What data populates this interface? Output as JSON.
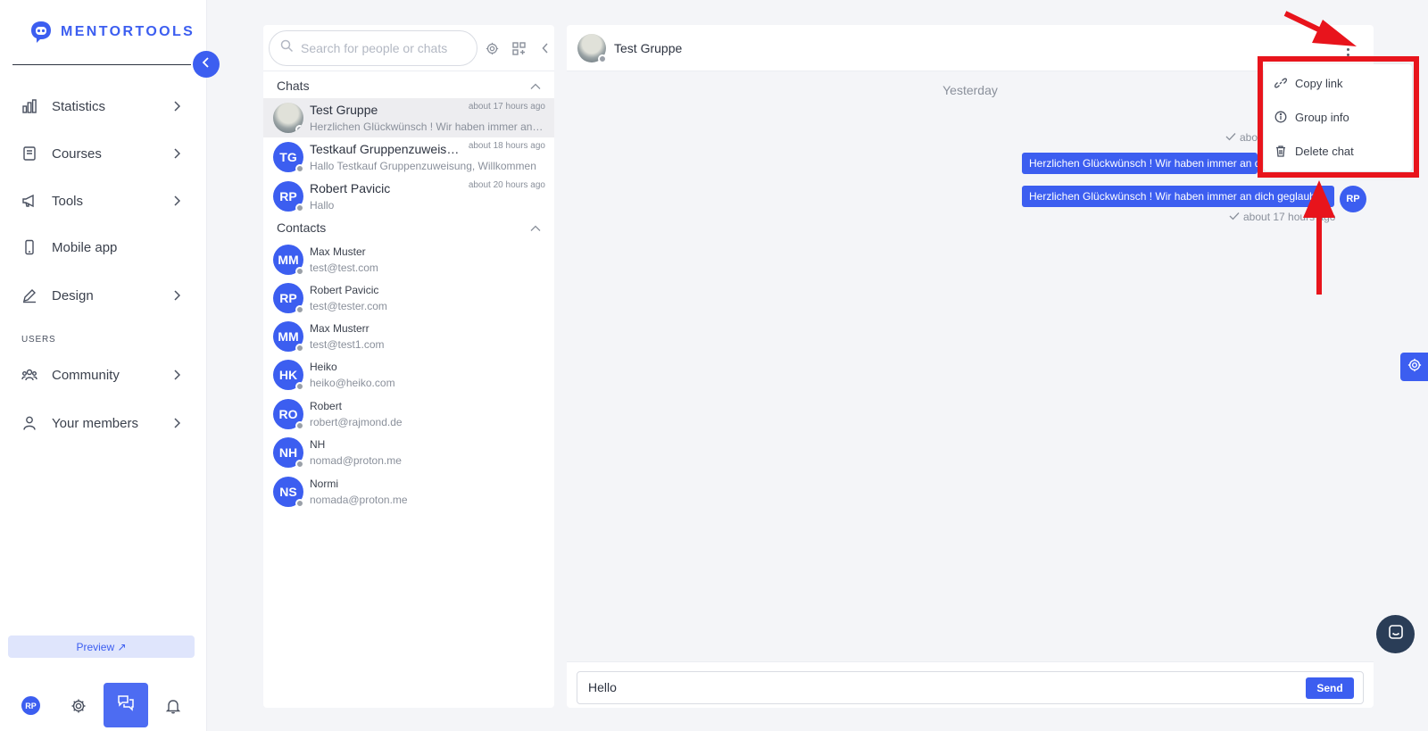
{
  "brand": {
    "name": "MENTORTOOLS",
    "color": "#3c5ef0"
  },
  "sidebar": {
    "items": [
      {
        "label": "Statistics",
        "icon": "bar-chart-icon",
        "has_chevron": true
      },
      {
        "label": "Courses",
        "icon": "book-icon",
        "has_chevron": true
      },
      {
        "label": "Tools",
        "icon": "megaphone-icon",
        "has_chevron": true
      },
      {
        "label": "Mobile app",
        "icon": "phone-icon",
        "has_chevron": false
      },
      {
        "label": "Design",
        "icon": "pencil-icon",
        "has_chevron": true
      }
    ],
    "users_section_label": "USERS",
    "user_items": [
      {
        "label": "Community",
        "icon": "users-icon",
        "has_chevron": true
      },
      {
        "label": "Your members",
        "icon": "user-icon",
        "has_chevron": true
      }
    ],
    "preview_label": "Preview ↗",
    "bottom": {
      "avatar_initials": "RP"
    }
  },
  "chat_list": {
    "search_placeholder": "Search for people or chats",
    "chats_heading": "Chats",
    "contacts_heading": "Contacts",
    "chats": [
      {
        "name": "Test Gruppe",
        "time": "about 17 hours ago",
        "preview": "Herzlichen Glückwünsch ! Wir haben immer an dich geglaubt",
        "avatar": "photo",
        "initials": ""
      },
      {
        "name": "Testkauf Gruppenzuweisung",
        "time": "about 18 hours ago",
        "preview": "Hallo Testkauf Gruppenzuweisung, Willkommen",
        "avatar": "initials",
        "initials": "TG"
      },
      {
        "name": "Robert Pavicic",
        "time": "about 20 hours ago",
        "preview": "Hallo",
        "avatar": "initials",
        "initials": "RP"
      }
    ],
    "contacts": [
      {
        "initials": "MM",
        "name": "Max Muster",
        "email": "test@test.com"
      },
      {
        "initials": "RP",
        "name": "Robert Pavicic",
        "email": "test@tester.com"
      },
      {
        "initials": "MM",
        "name": "Max Musterr",
        "email": "test@test1.com"
      },
      {
        "initials": "HK",
        "name": "Heiko",
        "email": "heiko@heiko.com"
      },
      {
        "initials": "RO",
        "name": "Robert",
        "email": "robert@rajmond.de"
      },
      {
        "initials": "NH",
        "name": "NH",
        "email": "nomad@proton.me"
      },
      {
        "initials": "NS",
        "name": "Normi",
        "email": "nomada@proton.me"
      }
    ]
  },
  "conversation": {
    "title": "Test Gruppe",
    "day_label": "Yesterday",
    "first_meta": "abo",
    "messages": [
      {
        "text": "Herzlichen Glückwünsch ! Wir haben immer an dich geglaubt"
      },
      {
        "text": "Herzlichen Glückwünsch ! Wir haben immer an dich geglaubt"
      }
    ],
    "last_meta": "about 17 hours ago",
    "message_avatar_initials": "RP",
    "composer_value": "Hello",
    "send_label": "Send"
  },
  "menu": {
    "items": [
      {
        "label": "Copy link",
        "icon": "link-icon"
      },
      {
        "label": "Group info",
        "icon": "info-icon"
      },
      {
        "label": "Delete chat",
        "icon": "trash-icon"
      }
    ]
  },
  "annotations": {
    "highlight_color": "#e8141c"
  }
}
